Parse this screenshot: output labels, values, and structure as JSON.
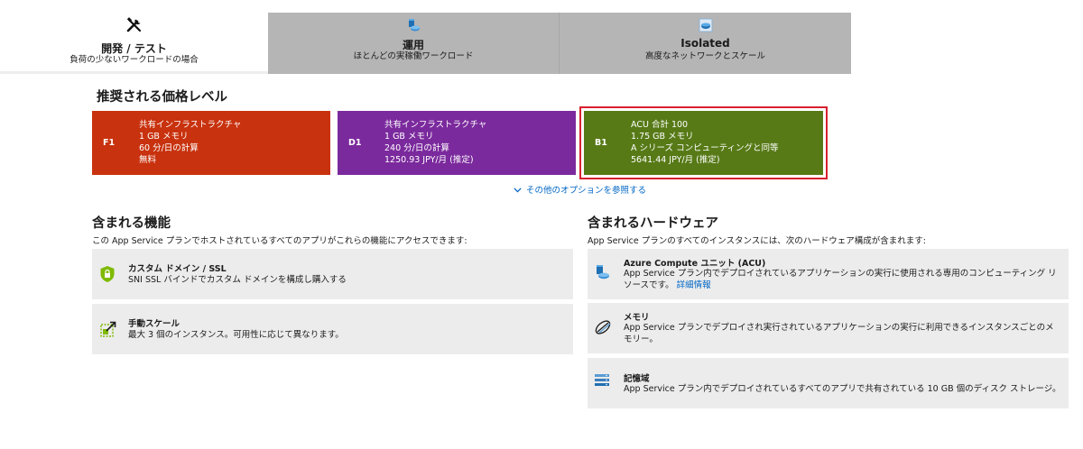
{
  "tabs": [
    {
      "title": "開発 / テスト",
      "subtitle": "負荷の少ないワークロードの場合",
      "icon": "tools-icon",
      "selected": true
    },
    {
      "title": "運用",
      "subtitle": "ほとんどの実稼働ワークロード",
      "icon": "production-icon",
      "selected": false
    },
    {
      "title": "Isolated",
      "subtitle": "高度なネットワークとスケール",
      "icon": "isolated-icon",
      "selected": false
    }
  ],
  "recommended": {
    "title": "推奨される価格レベル",
    "tiers": [
      {
        "code": "F1",
        "lines": [
          "共有インフラストラクチャ",
          "1 GB メモリ",
          "60 分/日の計算",
          "無料"
        ],
        "color": "#c8320e",
        "selected": false
      },
      {
        "code": "D1",
        "lines": [
          "共有インフラストラクチャ",
          "1 GB メモリ",
          "240 分/日の計算",
          "1250.93 JPY/月 (推定)"
        ],
        "color": "#7b2a9d",
        "selected": false
      },
      {
        "code": "B1",
        "lines": [
          "ACU 合計 100",
          "1.75 GB メモリ",
          "A シリーズ コンピューティングと同等",
          "5641.44 JPY/月 (推定)"
        ],
        "color": "#577a17",
        "selected": true
      }
    ],
    "more_options": "その他のオプションを参照する"
  },
  "features": {
    "title": "含まれる機能",
    "description": "この App Service プランでホストされているすべてのアプリがこれらの機能にアクセスできます:",
    "items": [
      {
        "title": "カスタム ドメイン / SSL",
        "text": "SNI SSL バインドでカスタム ドメインを構成し購入する",
        "icon": "ssl-shield-icon"
      },
      {
        "title": "手動スケール",
        "text": "最大 3 個のインスタンス。可用性に応じて異なります。",
        "icon": "manual-scale-icon"
      }
    ]
  },
  "hardware": {
    "title": "含まれるハードウェア",
    "description": "App Service プランのすべてのインスタンスには、次のハードウェア構成が含まれます:",
    "items": [
      {
        "title": "Azure Compute ユニット (ACU)",
        "text": "App Service プラン内でデプロイされているアプリケーションの実行に使用される専用のコンピューティング リソースです。",
        "link": "詳細情報",
        "icon": "compute-unit-icon"
      },
      {
        "title": "メモリ",
        "text": "App Service プランでデプロイされ実行されているアプリケーションの実行に利用できるインスタンスごとのメモリー。",
        "icon": "memory-icon"
      },
      {
        "title": "記憶域",
        "text": "App Service プラン内でデプロイされているすべてのアプリで共有されている 10 GB 個のディスク ストレージ。",
        "icon": "storage-icon"
      }
    ]
  }
}
